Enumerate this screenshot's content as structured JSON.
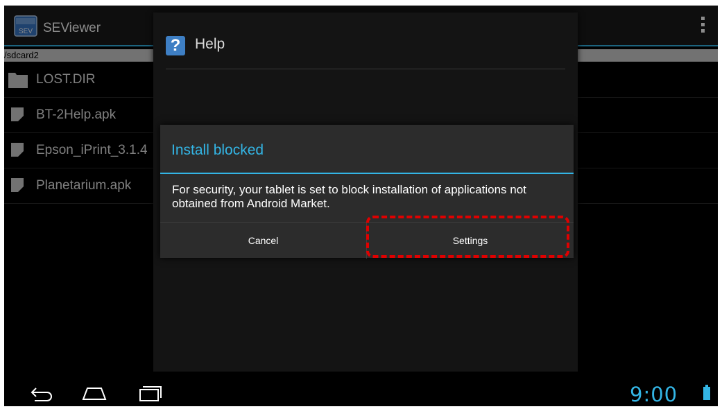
{
  "app": {
    "title": "SEViewer",
    "icon_text": "SEV"
  },
  "path": "/sdcard2",
  "files": [
    {
      "name": "LOST.DIR",
      "icon": "folder-icon"
    },
    {
      "name": "BT-2Help.apk",
      "icon": "file-icon"
    },
    {
      "name": "Epson_iPrint_3.1.4",
      "icon": "file-icon"
    },
    {
      "name": "Planetarium.apk",
      "icon": "file-icon"
    }
  ],
  "help_dialog": {
    "title": "Help",
    "icon_glyph": "?"
  },
  "install_dialog": {
    "title": "Install blocked",
    "message": "For security, your tablet is set to block installation of applications not obtained from Android Market.",
    "cancel_label": "Cancel",
    "settings_label": "Settings"
  },
  "status": {
    "clock": "9:00"
  },
  "colors": {
    "accent": "#33b5e5",
    "highlight": "#e00000"
  }
}
